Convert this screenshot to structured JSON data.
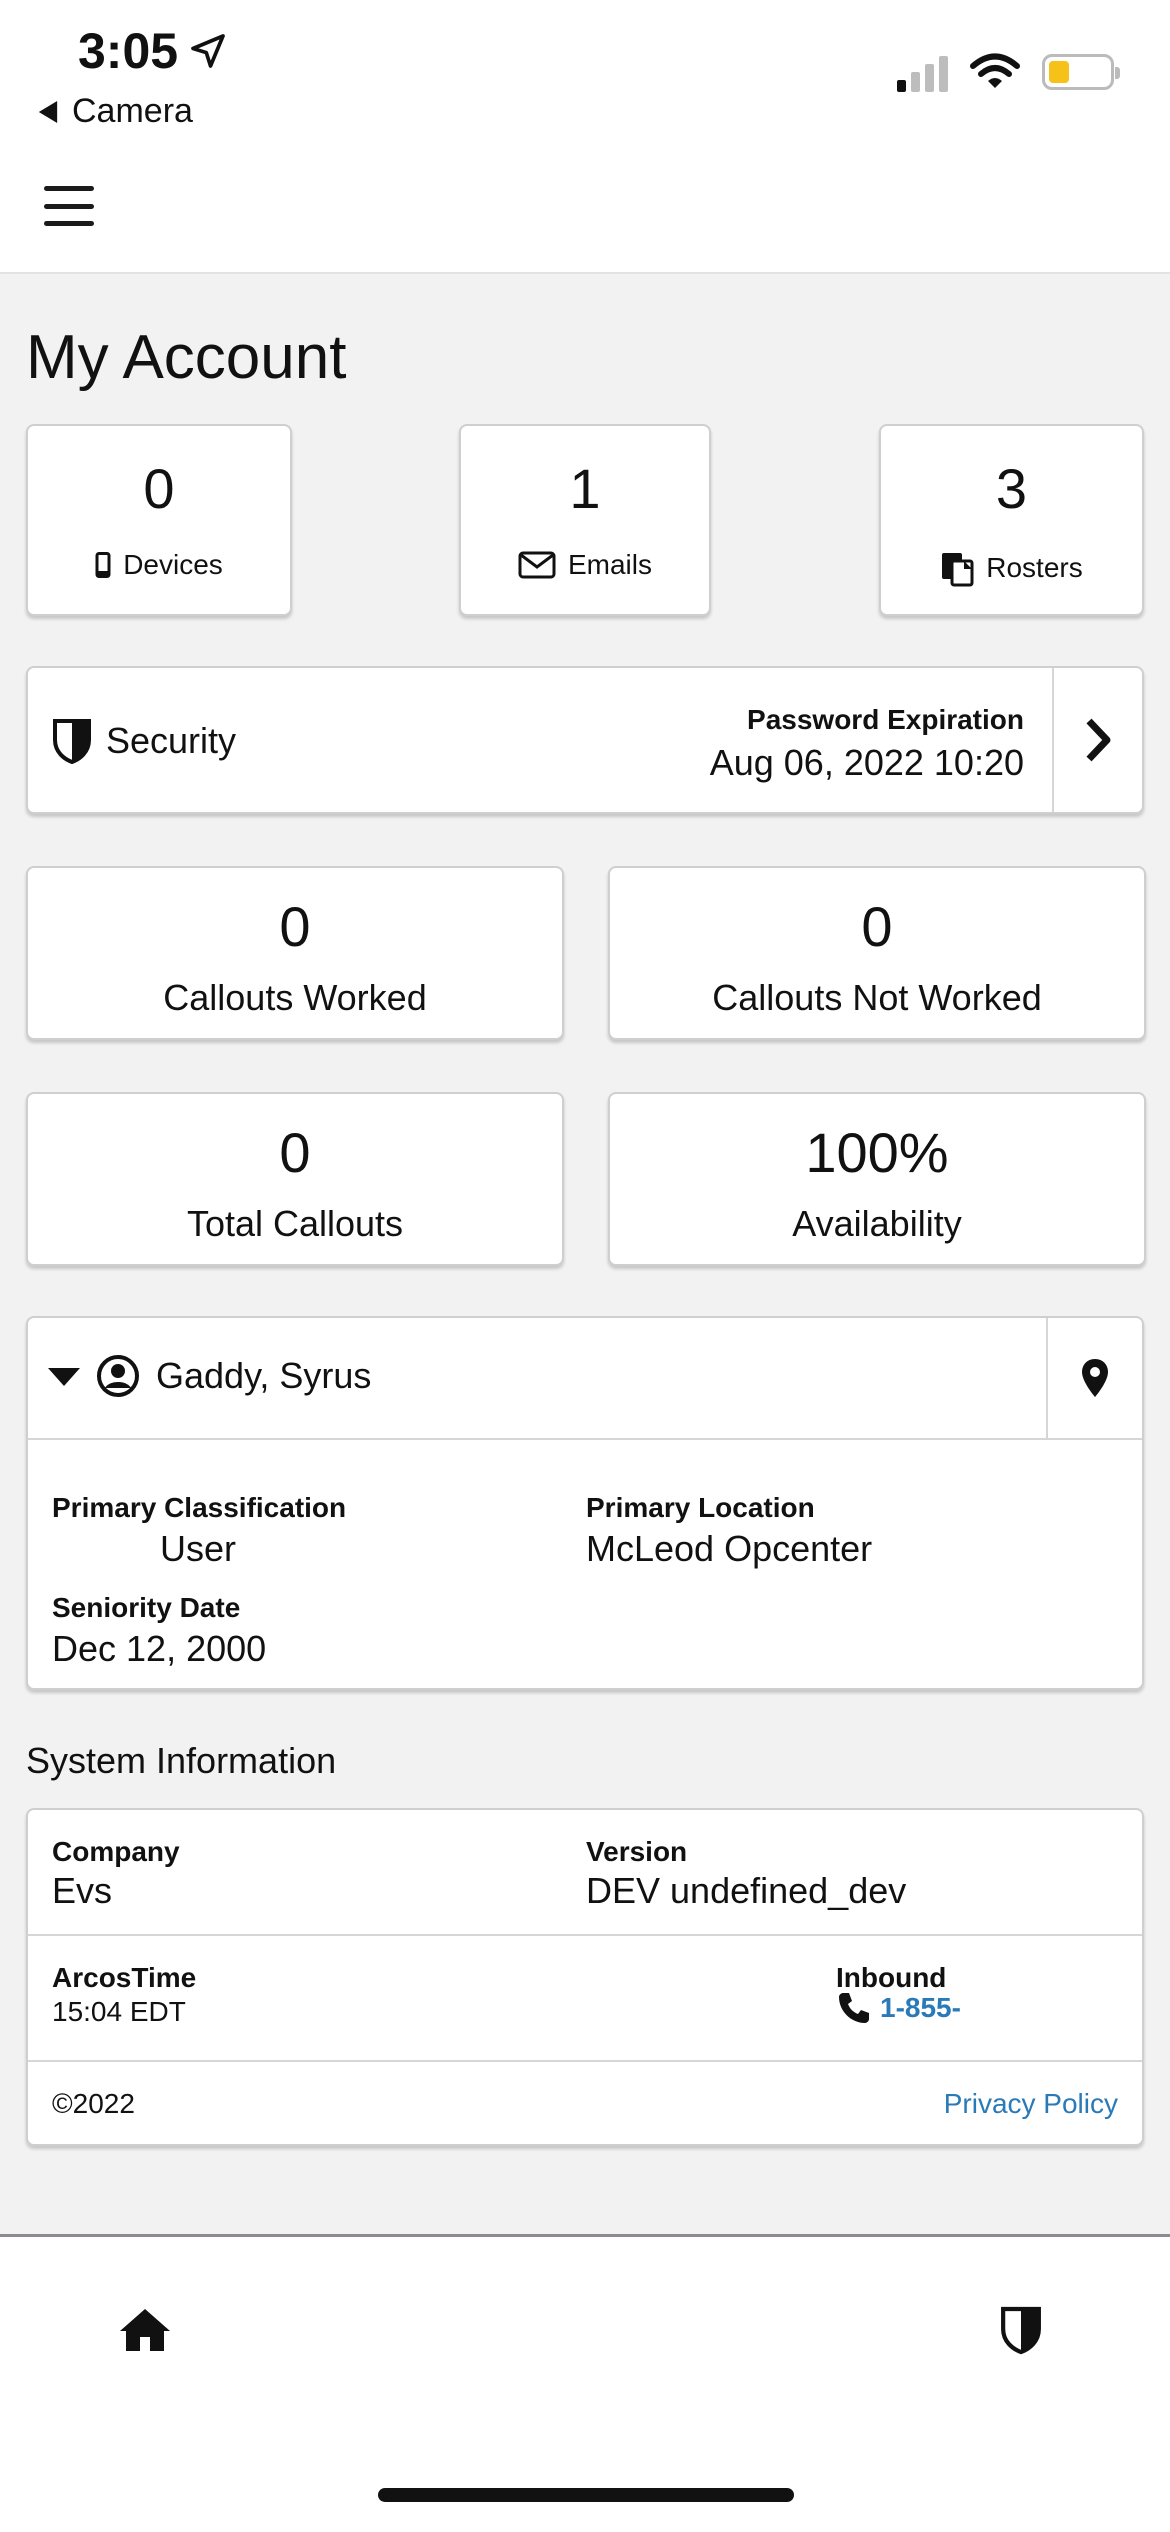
{
  "status_bar": {
    "time": "3:05",
    "back_app": "Camera"
  },
  "page": {
    "title": "My Account"
  },
  "counts": [
    {
      "value": "0",
      "label": "Devices",
      "icon": "phone-icon"
    },
    {
      "value": "1",
      "label": "Emails",
      "icon": "envelope-icon"
    },
    {
      "value": "3",
      "label": "Rosters",
      "icon": "clipboard-icon"
    }
  ],
  "security": {
    "label": "Security",
    "password_expiration_label": "Password Expiration",
    "password_expiration_value": "Aug 06, 2022 10:20"
  },
  "stats": [
    {
      "value": "0",
      "label": "Callouts Worked"
    },
    {
      "value": "0",
      "label": "Callouts Not Worked"
    },
    {
      "value": "0",
      "label": "Total Callouts"
    },
    {
      "value": "100%",
      "label": "Availability"
    }
  ],
  "profile": {
    "name": "Gaddy, Syrus",
    "primary_classification_label": "Primary Classification",
    "primary_classification_value": "User",
    "primary_location_label": "Primary Location",
    "primary_location_value": "McLeod Opcenter",
    "seniority_date_label": "Seniority Date",
    "seniority_date_value": "Dec 12, 2000"
  },
  "system_information": {
    "heading": "System Information",
    "company_label": "Company",
    "company_value": "Evs",
    "version_label": "Version",
    "version_value": "DEV undefined_dev",
    "arcos_time_label": "ArcosTime",
    "arcos_time_value": "15:04 EDT",
    "inbound_label": "Inbound",
    "inbound_value": "1-855-",
    "copyright": "©2022",
    "privacy_policy": "Privacy Policy"
  },
  "colors": {
    "link": "#2a7ab8",
    "battery": "#f6c21a",
    "background": "#f2f2f2"
  }
}
